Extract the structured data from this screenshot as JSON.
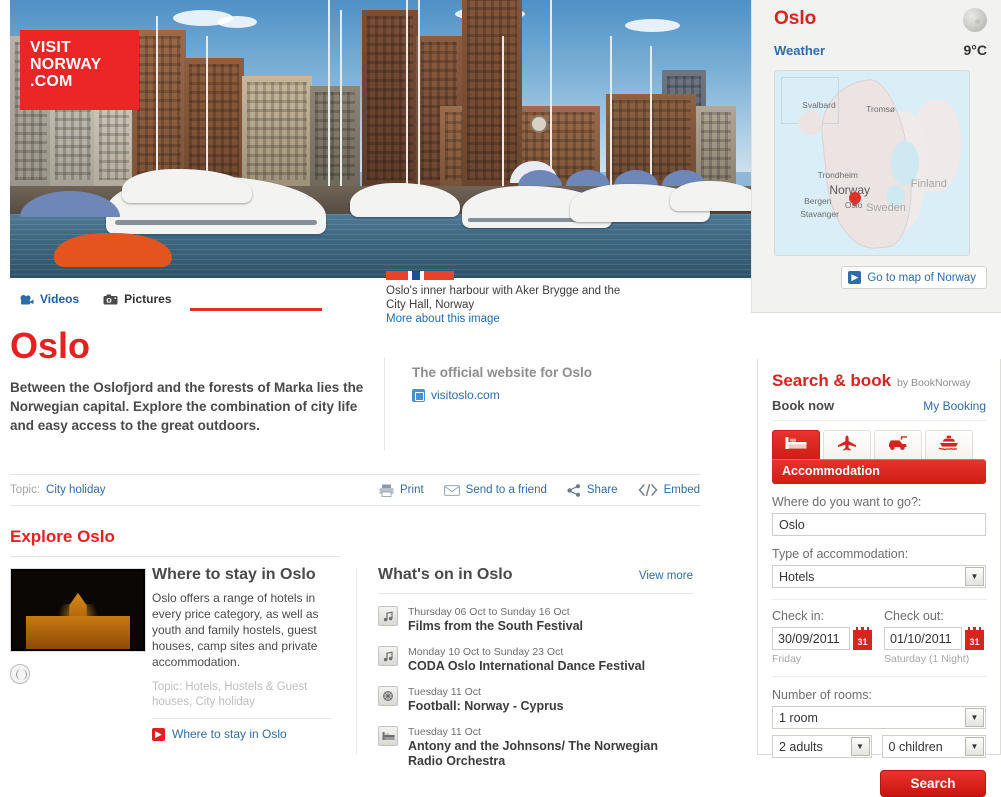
{
  "brand": {
    "logo_line1": "VISIT",
    "logo_line2": "NORWAY",
    "logo_line3": ".COM"
  },
  "hero": {
    "tabs": [
      {
        "label": "Videos",
        "icon": "video-camera-icon",
        "active": false
      },
      {
        "label": "Pictures",
        "icon": "photo-camera-icon",
        "active": true
      }
    ],
    "caption_line1": "Oslo's inner harbour with Aker Brygge and the",
    "caption_line2": "City Hall, Norway",
    "caption_link": "More about this image"
  },
  "weather": {
    "city": "Oslo",
    "label": "Weather",
    "temperature": "9°C",
    "icon": "cloudy-moon-icon",
    "map": {
      "labels": [
        {
          "text": "Svalbard",
          "type": "place"
        },
        {
          "text": "Tromsø",
          "type": "place"
        },
        {
          "text": "Trondheim",
          "type": "place"
        },
        {
          "text": "Norway",
          "type": "country-main"
        },
        {
          "text": "Bergen",
          "type": "place"
        },
        {
          "text": "Oslo",
          "type": "place"
        },
        {
          "text": "Stavanger",
          "type": "place"
        },
        {
          "text": "Sweden",
          "type": "country"
        },
        {
          "text": "Finland",
          "type": "country"
        }
      ]
    },
    "go_to_map": "Go to map of Norway"
  },
  "page": {
    "title": "Oslo",
    "lead": "Between the Oslofjord and the forests of Marka lies the Norwegian capital. Explore the combination of city life and easy access to the great outdoors."
  },
  "official": {
    "heading": "The official website for Oslo",
    "link": "visitoslo.com"
  },
  "toolbar": {
    "topic_label": "Topic:",
    "topic_value": "City holiday",
    "tools": [
      {
        "label": "Print",
        "icon": "printer-icon"
      },
      {
        "label": "Send to a friend",
        "icon": "envelope-icon"
      },
      {
        "label": "Share",
        "icon": "share-icon"
      },
      {
        "label": "Embed",
        "icon": "code-icon"
      }
    ]
  },
  "explore": {
    "heading": "Explore Oslo",
    "article": {
      "title": "Where to stay in Oslo",
      "body": "Oslo offers a range of hotels in every price category, as well as youth and family hostels, guest houses, camp sites and private accommodation.",
      "topic": "Topic: Hotels, Hostels & Guest houses, City holiday",
      "link": "Where to stay in Oslo",
      "thumbnail_alt": "illuminated-building-thumbnail",
      "globe_icon": "globe-icon"
    }
  },
  "whatson": {
    "heading": "What's on in Oslo",
    "view_more": "View more",
    "events": [
      {
        "date": "Thursday 06 Oct to Sunday 16 Oct",
        "title": "Films from the South Festival",
        "icon": "music-note-icon"
      },
      {
        "date": "Monday 10 Oct to Sunday 23 Oct",
        "title": "CODA Oslo International Dance Festival",
        "icon": "music-note-icon"
      },
      {
        "date": "Tuesday 11 Oct",
        "title": "Football: Norway - Cyprus",
        "icon": "sports-icon"
      },
      {
        "date": "Tuesday 11 Oct",
        "title": "Antony and the Johnsons/ The Norwegian Radio Orchestra",
        "icon": "bed-icon"
      }
    ]
  },
  "booking": {
    "heading": "Search & book",
    "by": "by BookNorway",
    "book_now": "Book now",
    "my_booking": "My Booking",
    "tabs": [
      {
        "name": "accommodation",
        "icon": "bed-icon",
        "active": true
      },
      {
        "name": "flights",
        "icon": "airplane-icon",
        "active": false
      },
      {
        "name": "car-rental",
        "icon": "car-icon",
        "active": false
      },
      {
        "name": "ferry",
        "icon": "ferry-icon",
        "active": false
      }
    ],
    "active_tab_label": "Accommodation",
    "destination_label": "Where do you want to go?:",
    "destination_value": "Oslo",
    "accommodation_label": "Type of accommodation:",
    "accommodation_value": "Hotels",
    "checkin_label": "Check in:",
    "checkin_value": "30/09/2011",
    "checkin_day": "Friday",
    "checkout_label": "Check out:",
    "checkout_value": "01/10/2011",
    "checkout_day": "Saturday (1 Night)",
    "calendar_icon_text": "31",
    "rooms_label": "Number of rooms:",
    "rooms_value": "1 room",
    "adults_value": "2 adults",
    "children_value": "0 children",
    "search_button": "Search"
  },
  "colors": {
    "brand_red": "#e8201f",
    "accent_red": "#d6251f",
    "link_blue": "#2f6ca6",
    "panel_grey": "#f2f2f0"
  }
}
